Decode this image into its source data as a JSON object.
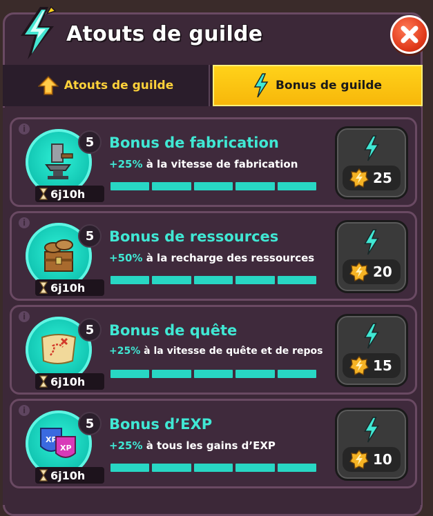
{
  "header": {
    "title": "Atouts de guilde"
  },
  "tabs": [
    {
      "label": "Atouts de guilde",
      "icon": "up-arrow-icon"
    },
    {
      "label": "Bonus de guilde",
      "icon": "lightning-icon"
    }
  ],
  "colors": {
    "accent": "#40e8d4",
    "tab_active": "#ffd21a",
    "close": "#e0391a"
  },
  "cards": [
    {
      "level": "5",
      "title": "Bonus de fabrication",
      "desc_pct": "+25%",
      "desc_rest": " à la vitesse de fabrication",
      "timer": "6j10h",
      "cost": "25",
      "icon": "anvil-hammer-icon"
    },
    {
      "level": "5",
      "title": "Bonus de ressources",
      "desc_pct": "+50%",
      "desc_rest": " à la recharge des ressources",
      "timer": "6j10h",
      "cost": "20",
      "icon": "resource-crate-icon"
    },
    {
      "level": "5",
      "title": "Bonus de quête",
      "desc_pct": "+25%",
      "desc_rest": " à la vitesse de quête et de repos",
      "timer": "6j10h",
      "cost": "15",
      "icon": "treasure-map-icon"
    },
    {
      "level": "5",
      "title": "Bonus d’EXP",
      "desc_pct": "+25%",
      "desc_rest": " à tous les gains d’EXP",
      "timer": "6j10h",
      "cost": "10",
      "icon": "xp-shields-icon"
    }
  ]
}
